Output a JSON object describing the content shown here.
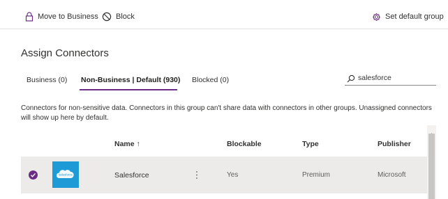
{
  "toolbar": {
    "move_to_business": "Move to Business",
    "block": "Block",
    "set_default_group": "Set default group"
  },
  "page_title": "Assign Connectors",
  "tabs": [
    {
      "label": "Business (0)",
      "active": false
    },
    {
      "label": "Non-Business | Default (930)",
      "active": true
    },
    {
      "label": "Blocked (0)",
      "active": false
    }
  ],
  "search": {
    "value": "salesforce"
  },
  "description": "Connectors for non-sensitive data. Connectors in this group can't share data with connectors in other groups. Unassigned connectors will show up here by default.",
  "table": {
    "columns": {
      "name": "Name ↑",
      "blockable": "Blockable",
      "type": "Type",
      "publisher": "Publisher"
    },
    "rows": [
      {
        "logo_text": "salesforce",
        "name": "Salesforce",
        "blockable": "Yes",
        "type": "Premium",
        "publisher": "Microsoft",
        "selected": true
      }
    ]
  },
  "colors": {
    "accent": "#6b2d84",
    "salesforce_blue": "#1e9bd7",
    "row_selected": "#edebe9"
  },
  "icons": [
    "lock-icon",
    "block-icon",
    "gear-icon",
    "search-icon",
    "checkmark-icon",
    "more-icon",
    "chevron-up-icon"
  ]
}
